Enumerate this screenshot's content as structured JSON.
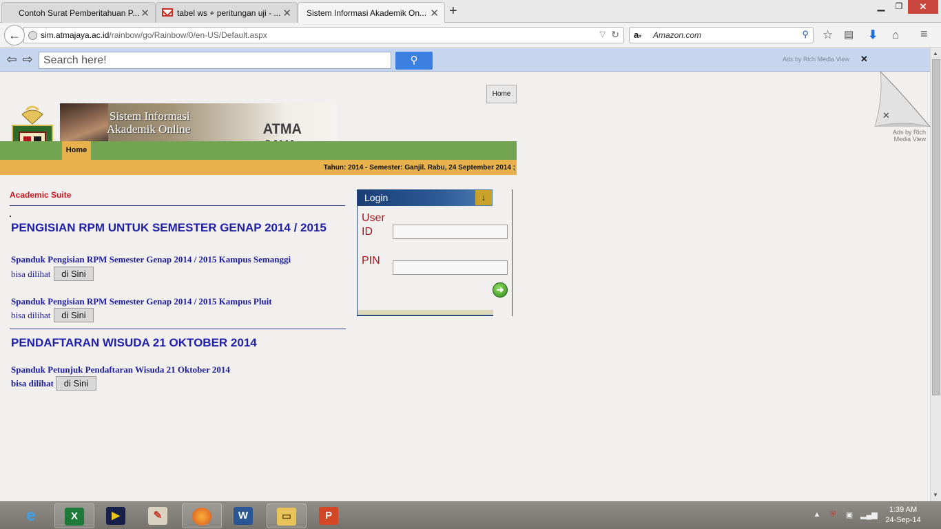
{
  "browser": {
    "tabs": [
      {
        "label": "Contoh Surat Pemberitahuan P...",
        "icon": "page-icon"
      },
      {
        "label": "tabel ws + peritungan uji - ...",
        "icon": "gmail-icon"
      },
      {
        "label": "Sistem Informasi Akademik On...",
        "icon": "page-icon"
      }
    ],
    "new_tab": "+",
    "url_domain": "sim.atmajaya.ac.id",
    "url_path": "/rainbow/go/Rainbow/0/en-US/Default.aspx",
    "search_engine_placeholder": "Amazon.com"
  },
  "toolbar": {
    "search_placeholder": "Search here!",
    "ads_label": "Ads by Rich Media View",
    "close": "✕"
  },
  "page": {
    "home_button": "Home",
    "banner_line1": "Sistem Informasi",
    "banner_line2": "Akademik Online",
    "brand": "ATMA JAYA",
    "nav_home": "Home",
    "status_line": "Tahun: 2014 - Semester: Ganjil.   Rabu, 24 September 2014 ;",
    "section_label": "Academic Suite",
    "heading1": "PENGISIAN RPM UNTUK SEMESTER GENAP 2014 / 2015",
    "link1": "Spanduk Pengisian RPM Semester Genap 2014 / 2015 Kampus Semanggi",
    "link2": "Spanduk Pengisian RPM Semester Genap 2014 / 2015 Kampus Pluit",
    "heading2": "PENDAFTARAN WISUDA 21 OKTOBER 2014",
    "link3": "Spanduk Petunjuk Pendaftaran Wisuda 21 Oktober 2014",
    "bisa_dilihat": "bisa dilihat",
    "di_sini": "di Sini"
  },
  "login": {
    "title": "Login",
    "user_label_1": "User",
    "user_label_2": "ID",
    "pin_label": "PIN",
    "user_value": "",
    "pin_value": ""
  },
  "curl_ad": {
    "label": "Ads by Rich Media View",
    "close": "✕"
  },
  "taskbar": {
    "time": "1:39 AM",
    "date": "24-Sep-14",
    "apps": [
      "internet-explorer-icon",
      "excel-icon",
      "media-player-icon",
      "paint-icon",
      "firefox-icon",
      "word-icon",
      "file-explorer-icon",
      "powerpoint-icon"
    ]
  },
  "colors": {
    "heading_blue": "#1e1ea8",
    "accent_red": "#d0141c",
    "green_bar": "#73a452",
    "orange_bar": "#e7b24c"
  }
}
